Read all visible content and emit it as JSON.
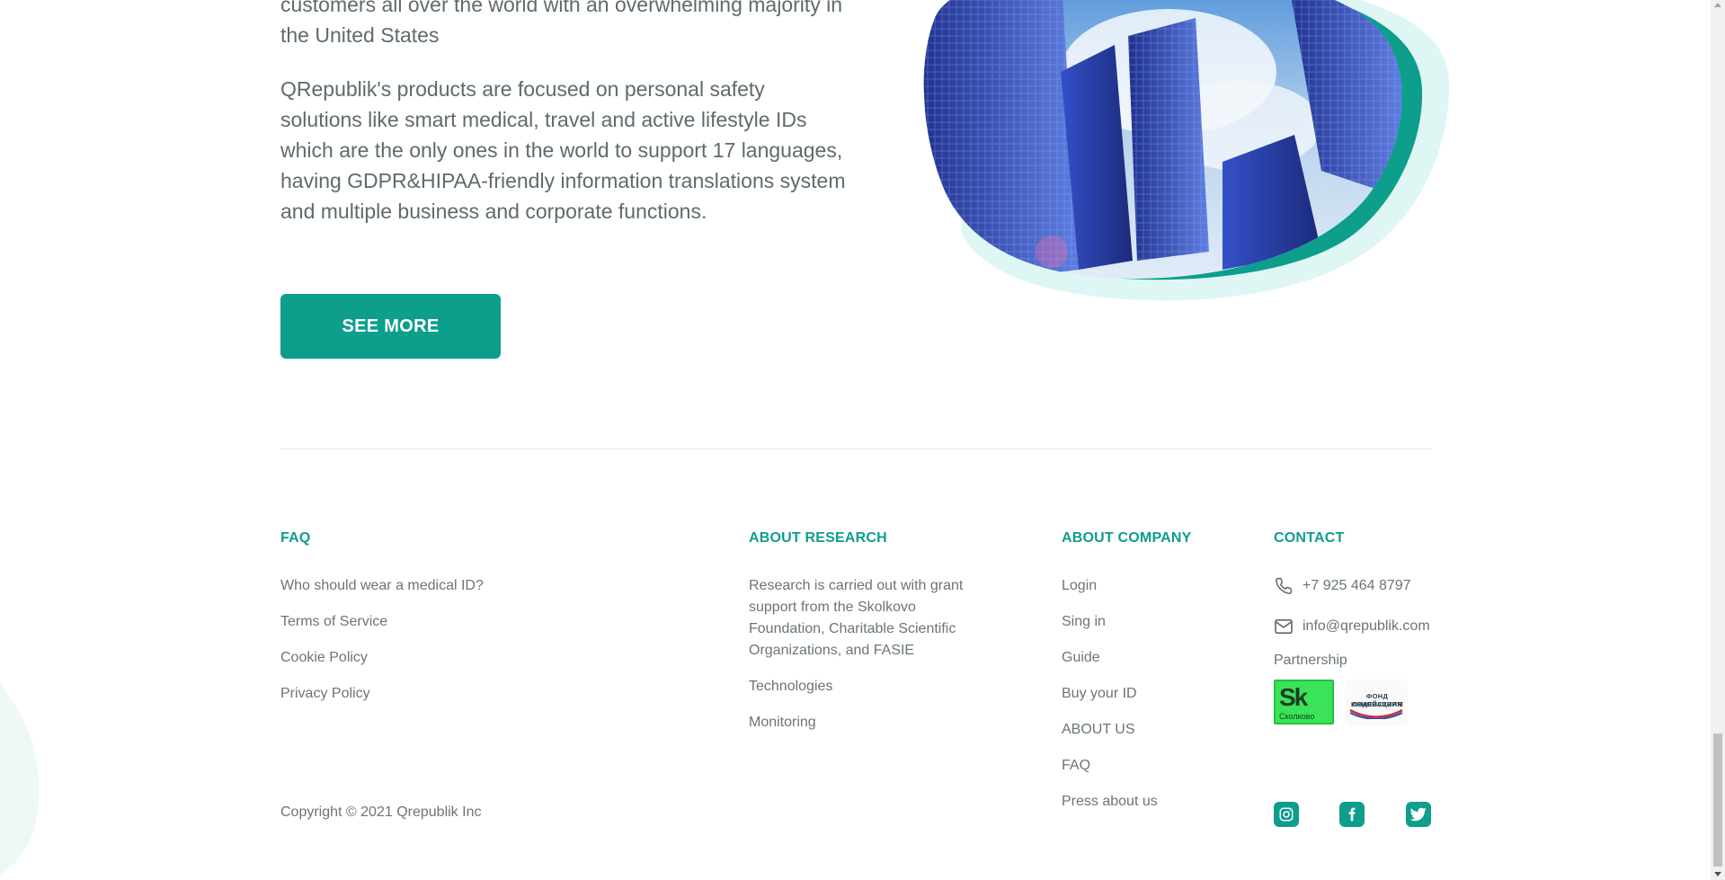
{
  "hero": {
    "para1": "customers all over the world with an overwhelming majority in the United States",
    "para2": "QRepublik's products are focused on personal safety solutions like smart medical, travel and active lifestyle IDs which are the only ones in the world to support 17 languages, having GDPR&HIPAA-friendly information translations system and multiple business and corporate functions.",
    "see_more_label": "SEE MORE"
  },
  "footer": {
    "faq": {
      "heading": "FAQ",
      "items": [
        "Who should wear a medical ID?",
        "Terms of Service",
        "Cookie Policy",
        "Privacy Policy"
      ]
    },
    "research": {
      "heading": "ABOUT RESEARCH",
      "text": "Research is carried out with grant support from the Skolkovo Foundation, Charitable Scientific Organizations, and FASIE",
      "items": [
        "Technologies",
        "Monitoring"
      ]
    },
    "company": {
      "heading": "ABOUT COMPANY",
      "items": [
        "Login",
        "Sing in",
        "Guide",
        "Buy your ID",
        "ABOUT US",
        "FAQ",
        "Press about us"
      ]
    },
    "contact": {
      "heading": "CONTACT",
      "phone": "+7 925 464 8797",
      "email": "info@qrepublik.com",
      "partnership_label": "Partnership",
      "skolkovo_logo_big": "Sk",
      "skolkovo_logo_small": "Сколково",
      "fond_logo_line1": "ФОНД СОДЕЙСТВИЯ",
      "fond_logo_line2": "ИННОВАЦИЯМ"
    },
    "copyright": "Copyright © 2021 Qrepublik Inc"
  },
  "colors": {
    "accent": "#0d9e8c",
    "text": "#5f6b6b",
    "divider": "#e6eaea"
  },
  "icons": {
    "phone": "phone-icon",
    "email": "mail-icon",
    "instagram": "instagram-icon",
    "facebook": "facebook-icon",
    "twitter": "twitter-icon"
  }
}
